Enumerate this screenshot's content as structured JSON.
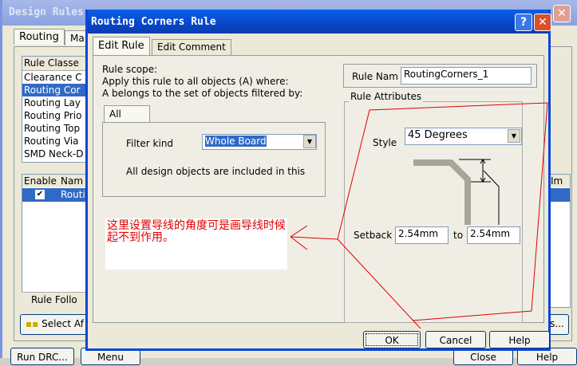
{
  "background_window": {
    "title": "Design Rules",
    "tabs": [
      "Routing",
      "Ma"
    ],
    "rule_classes_header": "Rule Classe",
    "rule_classes": [
      "Clearance C",
      "Routing Cor",
      "Routing Lay",
      "Routing Prio",
      "Routing Top",
      "Routing Via",
      "SMD Neck-D"
    ],
    "selected_class": 1,
    "columns": [
      "Enable",
      "Nam",
      "Im"
    ],
    "row_name": "Routi",
    "rule_follow": "Rule Follo",
    "select_button": "Select Af",
    "ellipsis_button": "s...",
    "run_drc": "Run DRC...",
    "menu": "Menu",
    "close": "Close",
    "help": "Help"
  },
  "dialog": {
    "title": "Routing Corners Rule",
    "tabs": [
      "Edit Rule",
      "Edit Comment"
    ],
    "scope_label": "Rule scope:",
    "scope_line1": "Apply this rule to all objects (A) where:",
    "scope_line2": "A belongs to the set of objects filtered by:",
    "filter_tab": "All",
    "filter_kind_label": "Filter kind",
    "filter_kind_value": "Whole Board",
    "filter_desc": "All design objects are included in this",
    "rule_name_label": "Rule Nam",
    "rule_name_value": "RoutingCorners_1",
    "attributes_label": "Rule Attributes",
    "style_label": "Style",
    "style_value": "45 Degrees",
    "setback_label": "Setback",
    "setback_from": "2.54mm",
    "setback_to_label": "to",
    "setback_to": "2.54mm",
    "ok": "OK",
    "cancel": "Cancel",
    "help": "Help"
  },
  "annotation": {
    "text": "这里设置导线的角度可是画导线时候起不到作用。",
    "color": "#e00000"
  }
}
